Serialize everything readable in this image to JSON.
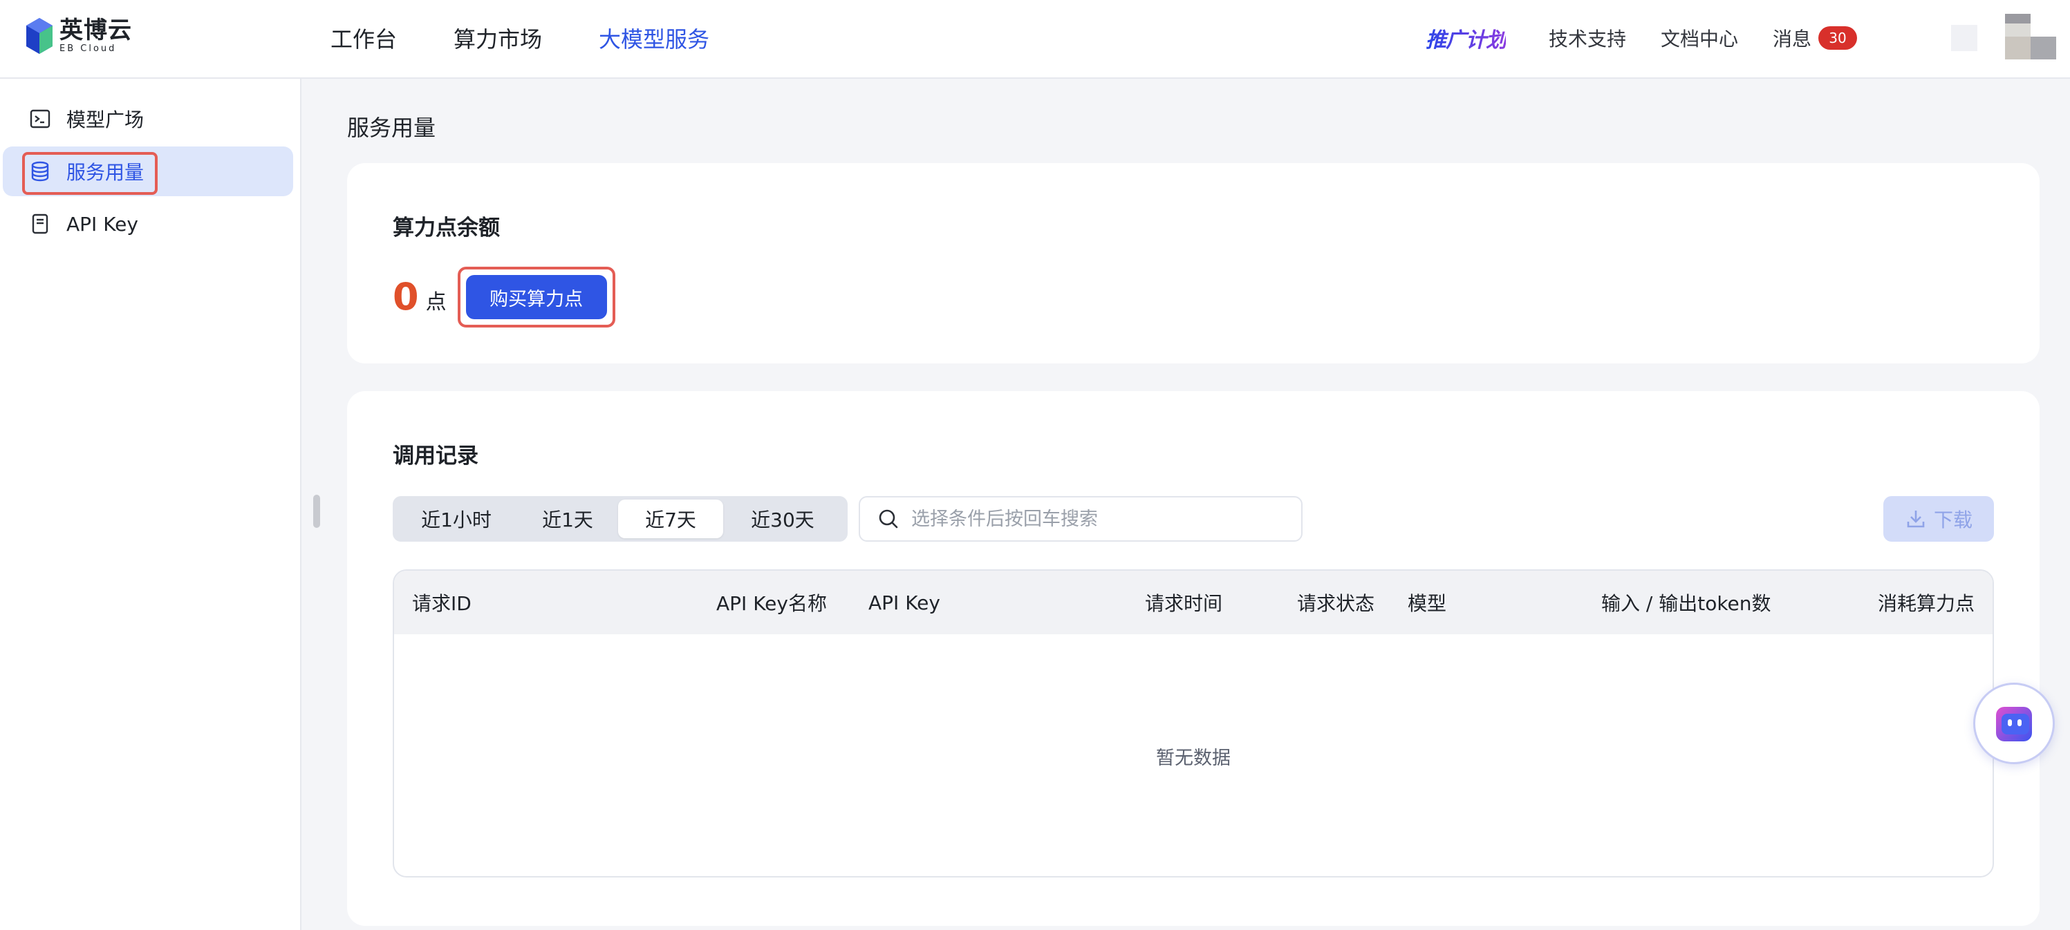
{
  "brand": {
    "name_cn": "英博云",
    "name_en": "EB Cloud"
  },
  "nav": {
    "items": [
      "工作台",
      "算力市场",
      "大模型服务"
    ],
    "active_index": 2
  },
  "top_right": {
    "promo": "推广计划",
    "support": "技术支持",
    "docs": "文档中心",
    "messages": "消息",
    "message_count": "30"
  },
  "sidebar": {
    "items": [
      {
        "label": "模型广场",
        "icon": "terminal-icon"
      },
      {
        "label": "服务用量",
        "icon": "database-icon"
      },
      {
        "label": "API Key",
        "icon": "key-card-icon"
      }
    ],
    "active_index": 1
  },
  "page": {
    "title": "服务用量"
  },
  "balance": {
    "title": "算力点余额",
    "value": "0",
    "unit": "点",
    "buy_label": "购买算力点"
  },
  "records": {
    "title": "调用记录",
    "ranges": [
      "近1小时",
      "近1天",
      "近7天",
      "近30天"
    ],
    "active_range": 2,
    "search_placeholder": "选择条件后按回车搜索",
    "search_value": "",
    "download_label": "下载",
    "columns": [
      "请求ID",
      "API Key名称",
      "API Key",
      "请求时间",
      "请求状态",
      "模型",
      "输入 / 输出token数",
      "消耗算力点"
    ],
    "rows": [],
    "empty_text": "暂无数据"
  },
  "colors": {
    "accent": "#2f55e4",
    "balance": "#e0502a",
    "badge": "#d8302b",
    "highlight": "#e45d55"
  }
}
